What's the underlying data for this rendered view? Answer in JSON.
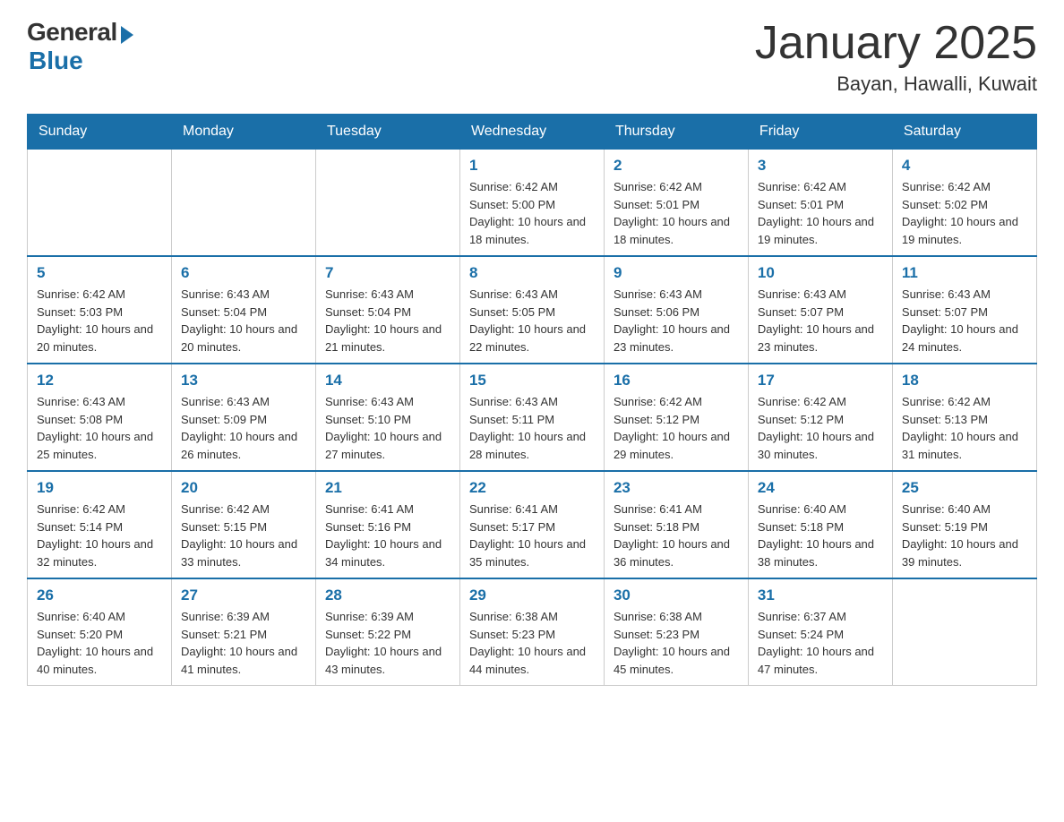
{
  "logo": {
    "general": "General",
    "blue": "Blue"
  },
  "title": "January 2025",
  "subtitle": "Bayan, Hawalli, Kuwait",
  "headers": [
    "Sunday",
    "Monday",
    "Tuesday",
    "Wednesday",
    "Thursday",
    "Friday",
    "Saturday"
  ],
  "weeks": [
    [
      {
        "day": "",
        "sunrise": "",
        "sunset": "",
        "daylight": ""
      },
      {
        "day": "",
        "sunrise": "",
        "sunset": "",
        "daylight": ""
      },
      {
        "day": "",
        "sunrise": "",
        "sunset": "",
        "daylight": ""
      },
      {
        "day": "1",
        "sunrise": "Sunrise: 6:42 AM",
        "sunset": "Sunset: 5:00 PM",
        "daylight": "Daylight: 10 hours and 18 minutes."
      },
      {
        "day": "2",
        "sunrise": "Sunrise: 6:42 AM",
        "sunset": "Sunset: 5:01 PM",
        "daylight": "Daylight: 10 hours and 18 minutes."
      },
      {
        "day": "3",
        "sunrise": "Sunrise: 6:42 AM",
        "sunset": "Sunset: 5:01 PM",
        "daylight": "Daylight: 10 hours and 19 minutes."
      },
      {
        "day": "4",
        "sunrise": "Sunrise: 6:42 AM",
        "sunset": "Sunset: 5:02 PM",
        "daylight": "Daylight: 10 hours and 19 minutes."
      }
    ],
    [
      {
        "day": "5",
        "sunrise": "Sunrise: 6:42 AM",
        "sunset": "Sunset: 5:03 PM",
        "daylight": "Daylight: 10 hours and 20 minutes."
      },
      {
        "day": "6",
        "sunrise": "Sunrise: 6:43 AM",
        "sunset": "Sunset: 5:04 PM",
        "daylight": "Daylight: 10 hours and 20 minutes."
      },
      {
        "day": "7",
        "sunrise": "Sunrise: 6:43 AM",
        "sunset": "Sunset: 5:04 PM",
        "daylight": "Daylight: 10 hours and 21 minutes."
      },
      {
        "day": "8",
        "sunrise": "Sunrise: 6:43 AM",
        "sunset": "Sunset: 5:05 PM",
        "daylight": "Daylight: 10 hours and 22 minutes."
      },
      {
        "day": "9",
        "sunrise": "Sunrise: 6:43 AM",
        "sunset": "Sunset: 5:06 PM",
        "daylight": "Daylight: 10 hours and 23 minutes."
      },
      {
        "day": "10",
        "sunrise": "Sunrise: 6:43 AM",
        "sunset": "Sunset: 5:07 PM",
        "daylight": "Daylight: 10 hours and 23 minutes."
      },
      {
        "day": "11",
        "sunrise": "Sunrise: 6:43 AM",
        "sunset": "Sunset: 5:07 PM",
        "daylight": "Daylight: 10 hours and 24 minutes."
      }
    ],
    [
      {
        "day": "12",
        "sunrise": "Sunrise: 6:43 AM",
        "sunset": "Sunset: 5:08 PM",
        "daylight": "Daylight: 10 hours and 25 minutes."
      },
      {
        "day": "13",
        "sunrise": "Sunrise: 6:43 AM",
        "sunset": "Sunset: 5:09 PM",
        "daylight": "Daylight: 10 hours and 26 minutes."
      },
      {
        "day": "14",
        "sunrise": "Sunrise: 6:43 AM",
        "sunset": "Sunset: 5:10 PM",
        "daylight": "Daylight: 10 hours and 27 minutes."
      },
      {
        "day": "15",
        "sunrise": "Sunrise: 6:43 AM",
        "sunset": "Sunset: 5:11 PM",
        "daylight": "Daylight: 10 hours and 28 minutes."
      },
      {
        "day": "16",
        "sunrise": "Sunrise: 6:42 AM",
        "sunset": "Sunset: 5:12 PM",
        "daylight": "Daylight: 10 hours and 29 minutes."
      },
      {
        "day": "17",
        "sunrise": "Sunrise: 6:42 AM",
        "sunset": "Sunset: 5:12 PM",
        "daylight": "Daylight: 10 hours and 30 minutes."
      },
      {
        "day": "18",
        "sunrise": "Sunrise: 6:42 AM",
        "sunset": "Sunset: 5:13 PM",
        "daylight": "Daylight: 10 hours and 31 minutes."
      }
    ],
    [
      {
        "day": "19",
        "sunrise": "Sunrise: 6:42 AM",
        "sunset": "Sunset: 5:14 PM",
        "daylight": "Daylight: 10 hours and 32 minutes."
      },
      {
        "day": "20",
        "sunrise": "Sunrise: 6:42 AM",
        "sunset": "Sunset: 5:15 PM",
        "daylight": "Daylight: 10 hours and 33 minutes."
      },
      {
        "day": "21",
        "sunrise": "Sunrise: 6:41 AM",
        "sunset": "Sunset: 5:16 PM",
        "daylight": "Daylight: 10 hours and 34 minutes."
      },
      {
        "day": "22",
        "sunrise": "Sunrise: 6:41 AM",
        "sunset": "Sunset: 5:17 PM",
        "daylight": "Daylight: 10 hours and 35 minutes."
      },
      {
        "day": "23",
        "sunrise": "Sunrise: 6:41 AM",
        "sunset": "Sunset: 5:18 PM",
        "daylight": "Daylight: 10 hours and 36 minutes."
      },
      {
        "day": "24",
        "sunrise": "Sunrise: 6:40 AM",
        "sunset": "Sunset: 5:18 PM",
        "daylight": "Daylight: 10 hours and 38 minutes."
      },
      {
        "day": "25",
        "sunrise": "Sunrise: 6:40 AM",
        "sunset": "Sunset: 5:19 PM",
        "daylight": "Daylight: 10 hours and 39 minutes."
      }
    ],
    [
      {
        "day": "26",
        "sunrise": "Sunrise: 6:40 AM",
        "sunset": "Sunset: 5:20 PM",
        "daylight": "Daylight: 10 hours and 40 minutes."
      },
      {
        "day": "27",
        "sunrise": "Sunrise: 6:39 AM",
        "sunset": "Sunset: 5:21 PM",
        "daylight": "Daylight: 10 hours and 41 minutes."
      },
      {
        "day": "28",
        "sunrise": "Sunrise: 6:39 AM",
        "sunset": "Sunset: 5:22 PM",
        "daylight": "Daylight: 10 hours and 43 minutes."
      },
      {
        "day": "29",
        "sunrise": "Sunrise: 6:38 AM",
        "sunset": "Sunset: 5:23 PM",
        "daylight": "Daylight: 10 hours and 44 minutes."
      },
      {
        "day": "30",
        "sunrise": "Sunrise: 6:38 AM",
        "sunset": "Sunset: 5:23 PM",
        "daylight": "Daylight: 10 hours and 45 minutes."
      },
      {
        "day": "31",
        "sunrise": "Sunrise: 6:37 AM",
        "sunset": "Sunset: 5:24 PM",
        "daylight": "Daylight: 10 hours and 47 minutes."
      },
      {
        "day": "",
        "sunrise": "",
        "sunset": "",
        "daylight": ""
      }
    ]
  ]
}
